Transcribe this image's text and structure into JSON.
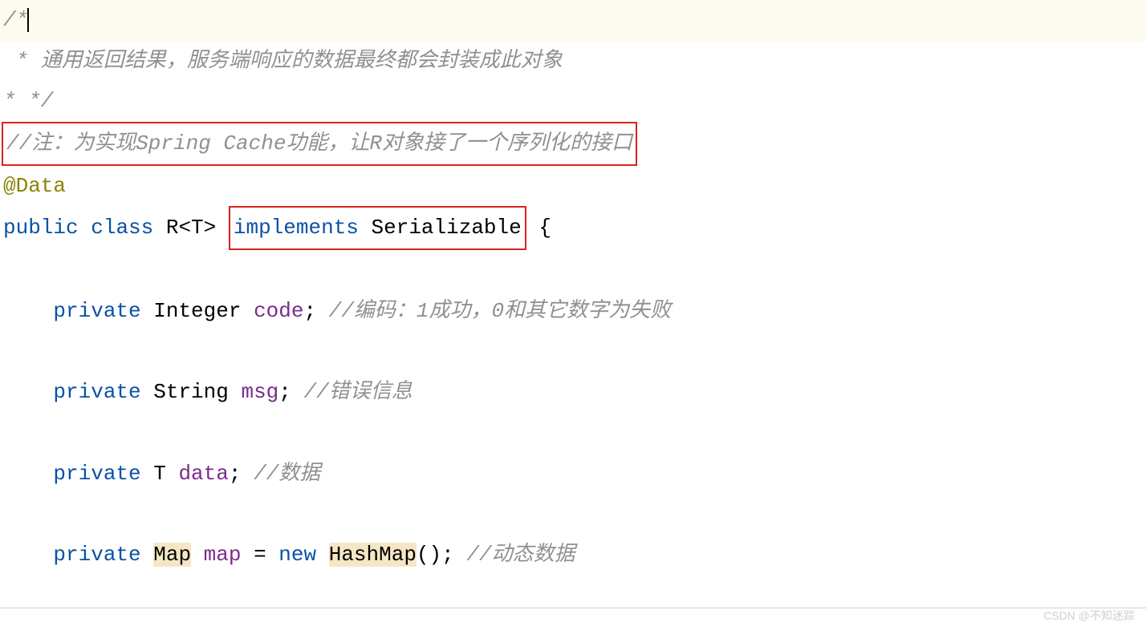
{
  "code": {
    "line1": "/*",
    "line2": " * 通用返回结果，服务端响应的数据最终都会封装成此对象",
    "line3": "* */",
    "line4": "//注：为实现Spring Cache功能，让R对象接了一个序列化的接口",
    "annotation": "@Data",
    "declaration": {
      "pub": "public",
      "cls": "class",
      "name": " R<T> ",
      "impl": "implements",
      "ser": " Serializable",
      "brace": " {"
    },
    "field1": {
      "kw": "private",
      "type": " Integer ",
      "name": "code",
      "semi": "; ",
      "comment": "//编码：1成功，0和其它数字为失败"
    },
    "field2": {
      "kw": "private",
      "type": " String ",
      "name": "msg",
      "semi": "; ",
      "comment": "//错误信息"
    },
    "field3": {
      "kw": "private",
      "type": " T ",
      "name": "data",
      "semi": "; ",
      "comment": "//数据"
    },
    "field4": {
      "kw": "private",
      "sp1": " ",
      "maptype": "Map",
      "sp2": " ",
      "name": "map",
      "eq": " = ",
      "newkw": "new",
      "sp3": " ",
      "hashmaptype": "HashMap",
      "paren": "(); ",
      "comment": "//动态数据"
    }
  },
  "watermark": "CSDN @不知迷踪"
}
